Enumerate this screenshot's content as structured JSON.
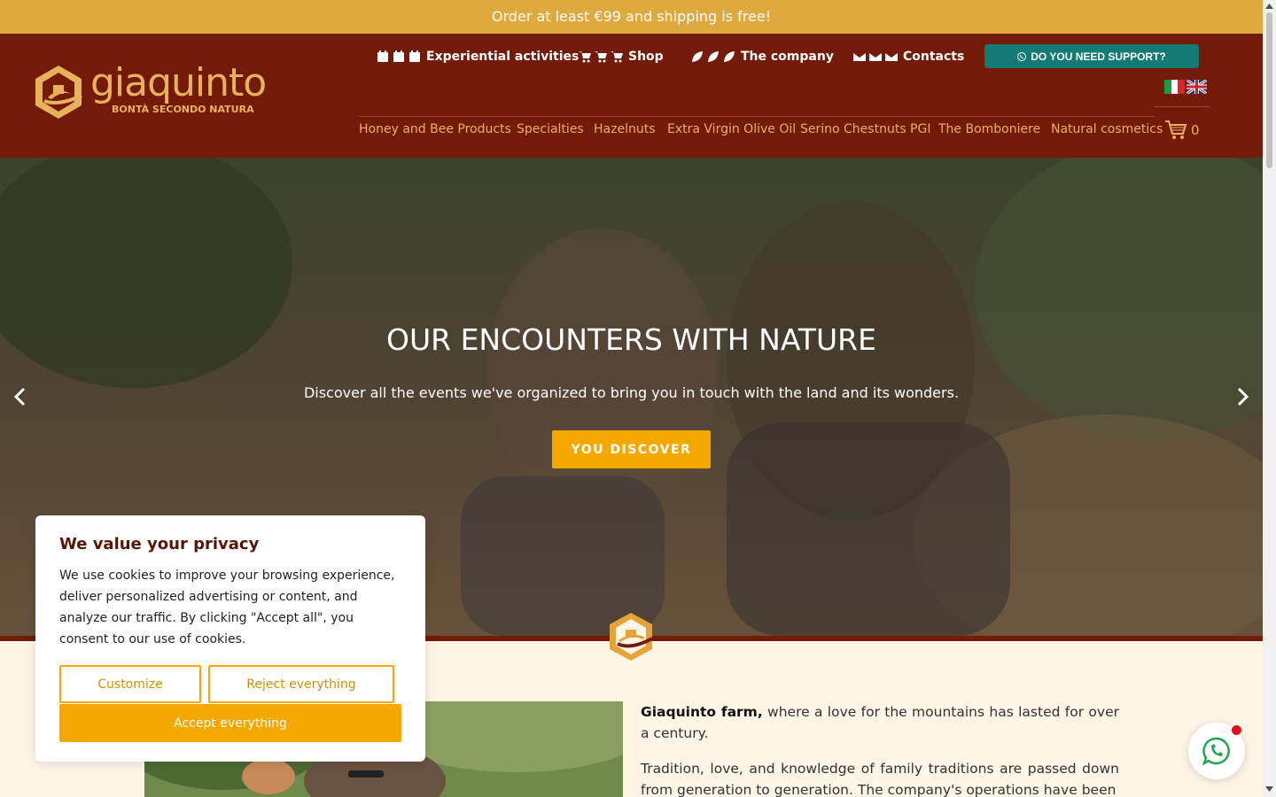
{
  "topbar": {
    "text": "Order at least €99 and shipping is free!"
  },
  "logo": {
    "word": "giaquinto",
    "tagline": "BONTÀ SECONDO NATURA"
  },
  "topnav": [
    {
      "label": "Experiential activities",
      "icon": "calendar-icon"
    },
    {
      "label": "Shop",
      "icon": "cart-icon"
    },
    {
      "label": "The company",
      "icon": "leaf-icon"
    },
    {
      "label": "Contacts",
      "icon": "envelope-icon"
    }
  ],
  "support": {
    "label": "DO YOU NEED SUPPORT?",
    "icon": "whatsapp-icon"
  },
  "mainnav": [
    "Honey and Bee Products",
    "Specialties",
    "Hazelnuts",
    "Extra Virgin Olive Oil",
    "Serino Chestnuts PGI",
    "The Bomboniere",
    "Natural cosmetics"
  ],
  "cart": {
    "count": "0"
  },
  "hero": {
    "title": "OUR ENCOUNTERS WITH NATURE",
    "subtitle": "Discover all the events we've organized to bring you in touch with the land and its wonders.",
    "button": "YOU DISCOVER"
  },
  "about": {
    "p1_bold": "Giaquinto farm,",
    "p1_rest": " where a love for the mountains has lasted for over a century.",
    "p2": "Tradition, love, and knowledge of family traditions are passed down from generation to generation. The company's operations have been"
  },
  "cookie": {
    "title": "We value your privacy",
    "text": "We use cookies to improve your browsing experience, deliver personalized advertising or content, and analyze our traffic. By clicking \"Accept all\", you consent to our use of cookies.",
    "customize": "Customize",
    "reject": "Reject everything",
    "accept": "Accept everything"
  },
  "colors": {
    "topbar": "#e0a93d",
    "header": "#741a08",
    "accent": "#f5a900",
    "nav_text": "#e8b25d",
    "support": "#137a74"
  }
}
